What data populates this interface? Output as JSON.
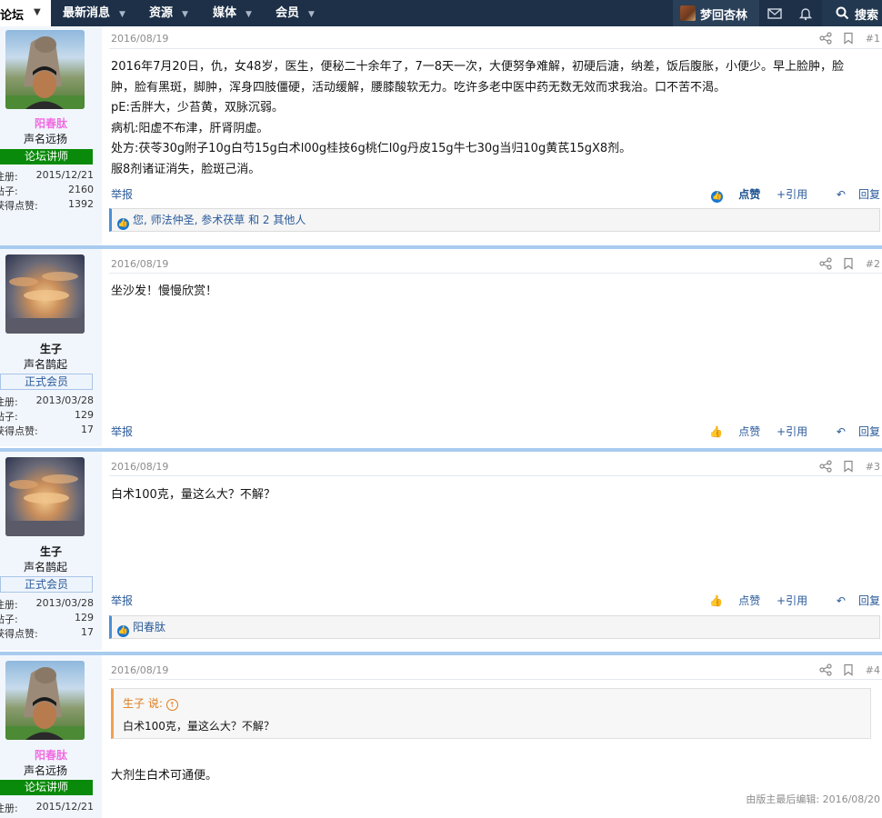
{
  "nav": {
    "active": "论坛",
    "items": [
      "最新消息",
      "资源",
      "媒体",
      "会员"
    ],
    "user": "梦回杏林",
    "search": "搜索"
  },
  "posts": [
    {
      "author": "阳春肽",
      "title": "声名远扬",
      "badge": "论坛讲师",
      "reg_label": "注册:",
      "reg": "2015/12/21",
      "posts_label": "帖子:",
      "posts": "2160",
      "likes_label": "获得点赞:",
      "likes": "1392",
      "date": "2016/08/19",
      "num": "#1",
      "lines": [
        "2016年7月20日，仇，女48岁，医生，便秘二十余年了，7一8天一次，大便努争难解，初硬后溏，纳差，饭后腹胀，小便少。早上脸肿，脸",
        "肿，脸有黑斑，脚肿，浑身四肢僵硬，活动缓解，腰膝酸软无力。吃许多老中医中药无数无效而求我治。口不苦不渴。",
        "pE:舌胖大，少苔黄，双脉沉弱。",
        "病机:阳虚不布津，肝肾阴虚。",
        "处方:茯苓30g附子10g白芍15g白术l00g桂技6g桃仁l0g丹皮15g牛七30g当归10g黄芪15gX8剂。",
        "服8剂诸证消失，脸斑己消。"
      ],
      "report": "举报",
      "like": "点赞",
      "quote": "+引用",
      "reply": "回复",
      "liked_by": "您, 师法仲圣, 参术茯草 和 2 其他人"
    },
    {
      "author": "生子",
      "title": "声名鹊起",
      "badge": "正式会员",
      "reg_label": "注册:",
      "reg": "2013/03/28",
      "posts_label": "帖子:",
      "posts": "129",
      "likes_label": "获得点赞:",
      "likes": "17",
      "date": "2016/08/19",
      "num": "#2",
      "text": "坐沙发！慢慢欣赏！",
      "report": "举报",
      "like": "点赞",
      "quote": "+引用",
      "reply": "回复"
    },
    {
      "author": "生子",
      "title": "声名鹊起",
      "badge": "正式会员",
      "reg_label": "注册:",
      "reg": "2013/03/28",
      "posts_label": "帖子:",
      "posts": "129",
      "likes_label": "获得点赞:",
      "likes": "17",
      "date": "2016/08/19",
      "num": "#3",
      "text": "白术100克，量这么大？不解？",
      "report": "举报",
      "like": "点赞",
      "quote": "+引用",
      "reply": "回复",
      "liked_by": "阳春肽"
    },
    {
      "author": "阳春肽",
      "title": "声名远扬",
      "badge": "论坛讲师",
      "reg_label": "注册:",
      "reg": "2015/12/21",
      "date": "2016/08/19",
      "num": "#4",
      "quote_head": "生子 说:",
      "quote_text": "白术100克，量这么大？不解？",
      "text": "大剂生白术可通便。",
      "edited": "由版主最后编辑: 2016/08/20"
    }
  ],
  "colors": {
    "nav_bg": "#1d3048",
    "link": "#2a5a99",
    "badge_green": "#0a8a0a",
    "separator": "#a9cbef",
    "pink_name": "#f06ce0"
  }
}
